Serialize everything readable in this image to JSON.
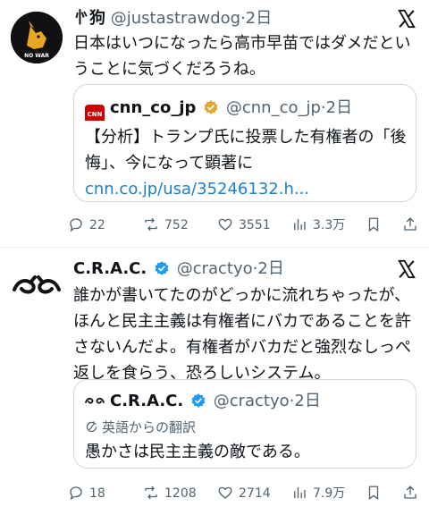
{
  "colors": {
    "link": "#1d7fc7",
    "muted": "#536471",
    "verified": "#e0a82e",
    "border": "#cfd9de"
  },
  "tweets": [
    {
      "author": {
        "name": "㣺狗",
        "handle": "@justastrawdog",
        "avatar_text": "NO WAR"
      },
      "dot": "·",
      "time": "2日",
      "text_lines": [
        "日本はいつになったら高市早苗ではダメだとい",
        "うことに気づくだろうね。"
      ],
      "quote": {
        "author": {
          "name": "cnn_co_jp",
          "handle": "@cnn_co_jp",
          "avatar_text": "CNN"
        },
        "dot": "·",
        "time": "2日",
        "text_lines": [
          "【分析】トランプ氏に投票した有権者の「後",
          "悔」、今になって顕著に"
        ],
        "link": "cnn.co.jp/usa/35246132.h..."
      },
      "actions": {
        "replies": "22",
        "reposts": "752",
        "likes": "3551",
        "views": "3.3万"
      }
    },
    {
      "author": {
        "name": "C.R.A.C.",
        "handle": "@cractyo"
      },
      "dot": "·",
      "time": "2日",
      "text_lines": [
        "誰かが書いてたのがどっかに流れちゃったが、",
        "ほんと民主主義は有権者にバカであることを許",
        "さないんだよ。有権者がバカだと強烈なしっぺ",
        "返しを食らう、恐ろしいシステム。"
      ],
      "quote": {
        "author": {
          "name": "C.R.A.C.",
          "handle": "@cractyo"
        },
        "dot": "·",
        "time": "2日",
        "translated_label": "英語からの翻訳",
        "text_lines": [
          "愚かさは民主主義の敵である。"
        ]
      },
      "actions": {
        "replies": "18",
        "reposts": "1208",
        "likes": "2714",
        "views": "7.9万"
      }
    }
  ]
}
